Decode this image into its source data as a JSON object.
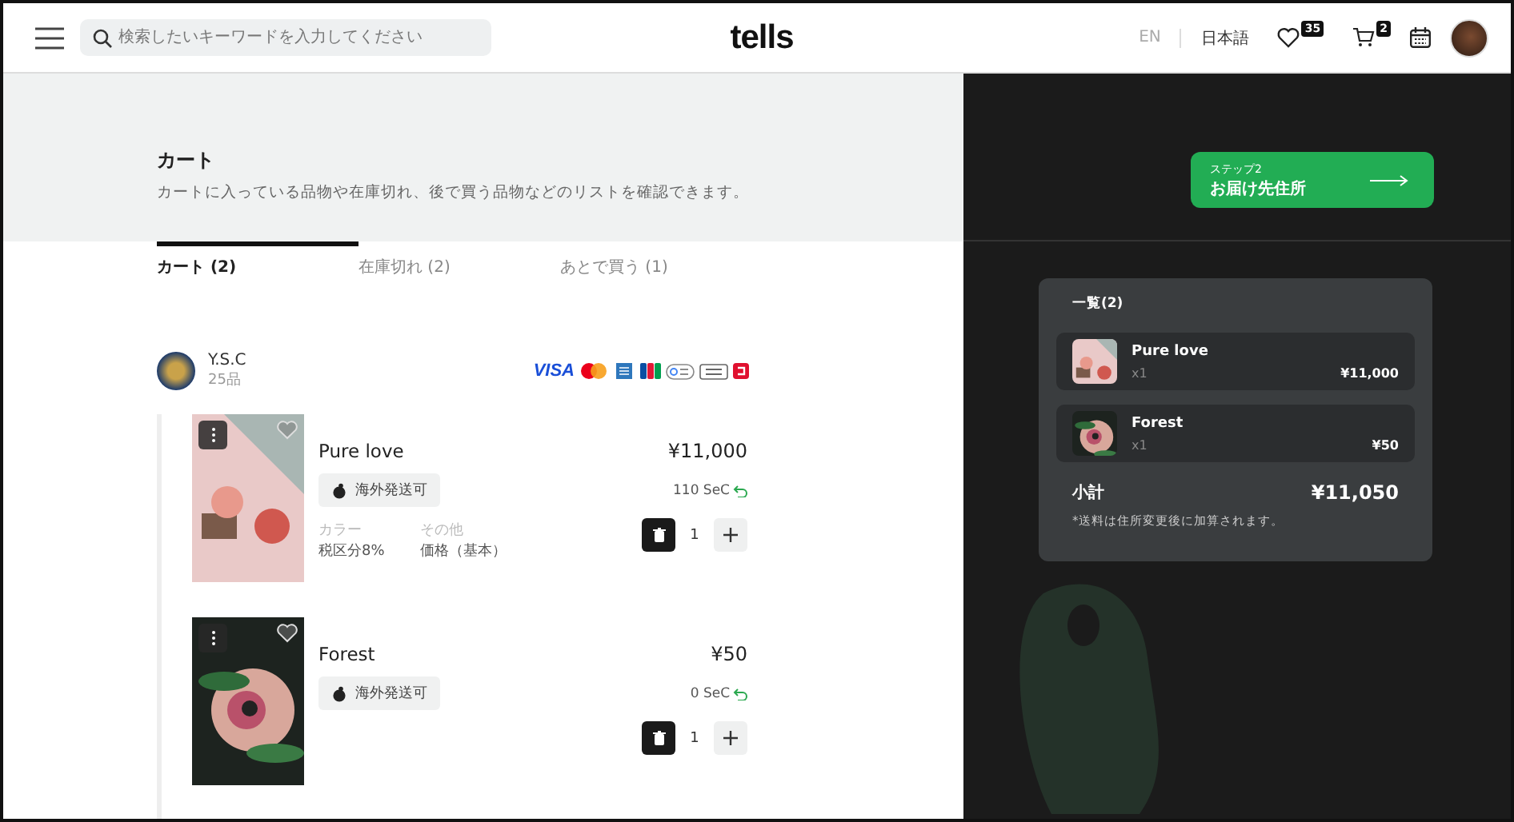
{
  "header": {
    "search": {
      "placeholder": "検索したいキーワードを入力してください"
    },
    "logo": "tells",
    "languages": [
      {
        "label": "EN",
        "selected": false
      },
      {
        "label": "日本語",
        "selected": true
      }
    ],
    "favorites_count": "35",
    "cart_count": "2"
  },
  "page": {
    "title": "カート",
    "subtitle": "カートに入っている品物や在庫切れ、後で買う品物などのリストを確認できます。"
  },
  "tabs": [
    {
      "label": "カート (2)",
      "selected": true
    },
    {
      "label": "在庫切れ (2)",
      "selected": false
    },
    {
      "label": "あとで買う (1)",
      "selected": false
    }
  ],
  "store": {
    "name": "Y.S.C",
    "count": "25品",
    "payment_methods": [
      {
        "kind": "visa",
        "label": "VISA"
      },
      {
        "kind": "mastercard"
      },
      {
        "kind": "amex"
      },
      {
        "kind": "jcb"
      },
      {
        "kind": "gpay"
      },
      {
        "kind": "applepay"
      },
      {
        "kind": "other"
      }
    ]
  },
  "items": [
    {
      "name": "Pure love",
      "price": "¥11,000",
      "badge": "海外発送可",
      "points": "110 SeC",
      "options": [
        {
          "label": "カラー",
          "value": "税区分8%"
        },
        {
          "label": "その他",
          "value": "価格（基本）"
        }
      ],
      "quantity": "1",
      "kind": "pink"
    },
    {
      "name": "Forest",
      "price": "¥50",
      "badge": "海外発送可",
      "points": "0 SeC",
      "quantity": "1",
      "kind": "dark"
    }
  ],
  "next_step": {
    "step": "ステップ2",
    "label": "お届け先住所"
  },
  "summary": {
    "title": "一覧(2)",
    "items": [
      {
        "name": "Pure love",
        "qty": "x1",
        "price": "¥11,000",
        "kind": "pink"
      },
      {
        "name": "Forest",
        "qty": "x1",
        "price": "¥50",
        "kind": "dark"
      }
    ],
    "subtotal_label": "小計",
    "subtotal": "¥11,050",
    "note": "*送料は住所変更後に加算されます。"
  }
}
